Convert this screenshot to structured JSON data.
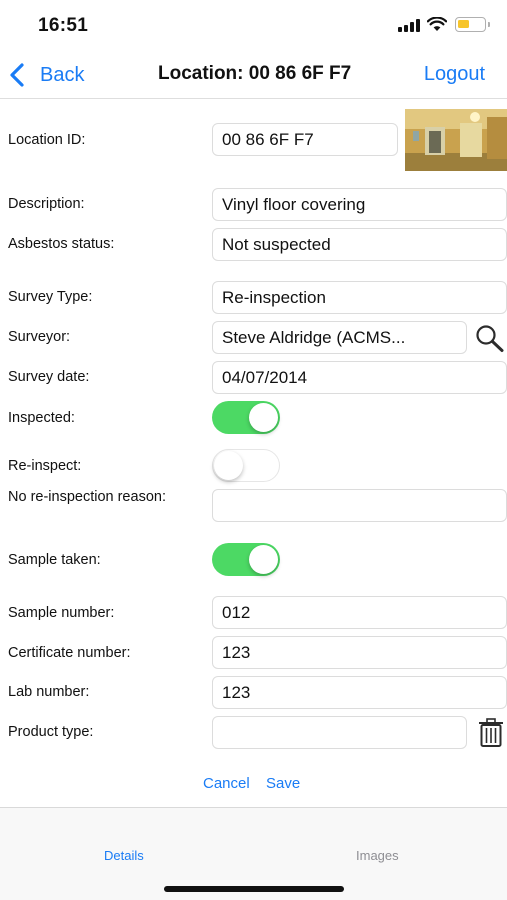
{
  "status_bar": {
    "time": "16:51"
  },
  "nav": {
    "back_label": "Back",
    "title": "Location: 00 86 6F F7",
    "logout_label": "Logout"
  },
  "form": {
    "location_id": {
      "label": "Location ID:",
      "value": "00 86 6F F7"
    },
    "description": {
      "label": "Description:",
      "value": "Vinyl floor covering"
    },
    "asbestos_status": {
      "label": "Asbestos status:",
      "value": "Not suspected"
    },
    "survey_type": {
      "label": "Survey Type:",
      "value": "Re-inspection"
    },
    "surveyor": {
      "label": "Surveyor:",
      "value": "Steve Aldridge (ACMS..."
    },
    "survey_date": {
      "label": "Survey date:",
      "value": "04/07/2014"
    },
    "inspected": {
      "label": "Inspected:",
      "on": true
    },
    "re_inspect": {
      "label": "Re-inspect:",
      "on": false
    },
    "no_reinspection_reason": {
      "label": "No re-inspection reason:",
      "value": ""
    },
    "sample_taken": {
      "label": "Sample taken:",
      "on": true
    },
    "sample_number": {
      "label": "Sample number:",
      "value": "012"
    },
    "certificate_number": {
      "label": "Certificate number:",
      "value": "123"
    },
    "lab_number": {
      "label": "Lab number:",
      "value": "123"
    },
    "product_type": {
      "label": "Product type:",
      "value": ""
    }
  },
  "actions": {
    "cancel_label": "Cancel",
    "save_label": "Save"
  },
  "tabs": [
    {
      "label": "Details",
      "active": true
    },
    {
      "label": "Images",
      "active": false
    }
  ],
  "icons": {
    "back": "chevron-left-icon",
    "search": "magnifier-icon",
    "delete": "trash-icon"
  },
  "colors": {
    "accent": "#1a7cf5",
    "toggle_on": "#4cd964",
    "battery": "#f7c52b"
  }
}
